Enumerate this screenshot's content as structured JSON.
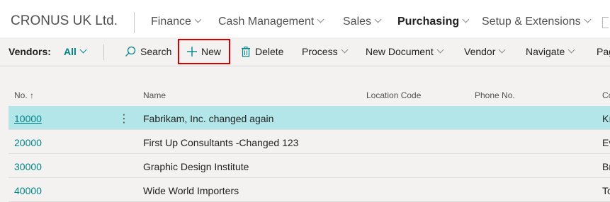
{
  "topbar": {
    "company": "CRONUS UK Ltd.",
    "nav": [
      "Finance",
      "Cash Management",
      "Sales",
      "Purchasing",
      "Setup & Extensions"
    ],
    "active": "Purchasing"
  },
  "actionbar": {
    "vendors_label": "Vendors:",
    "filter_value": "All",
    "search": "Search",
    "new": "New",
    "delete": "Delete",
    "process": "Process",
    "new_document": "New Document",
    "vendor": "Vendor",
    "navigate": "Navigate",
    "page_partial": "Pag"
  },
  "table": {
    "columns": [
      "No.",
      "Name",
      "Location Code",
      "Phone No.",
      "Co"
    ],
    "sort_indicator": "↑",
    "rows": [
      {
        "no": "10000",
        "name": "Fabrikam, Inc. changed again",
        "partial": "Kı"
      },
      {
        "no": "20000",
        "name": "First Up Consultants -Changed 123",
        "partial": "Ev"
      },
      {
        "no": "30000",
        "name": "Graphic Design Institute",
        "partial": "Br"
      },
      {
        "no": "40000",
        "name": "Wide World Importers",
        "partial": "To"
      }
    ]
  },
  "colors": {
    "accent": "#008489",
    "selected_row": "#b2e6e9",
    "highlight_box": "#d20000"
  },
  "icons": {
    "search": "search-icon",
    "new": "plus-icon",
    "delete": "trash-icon",
    "row_menu": "more-vertical-icon"
  }
}
